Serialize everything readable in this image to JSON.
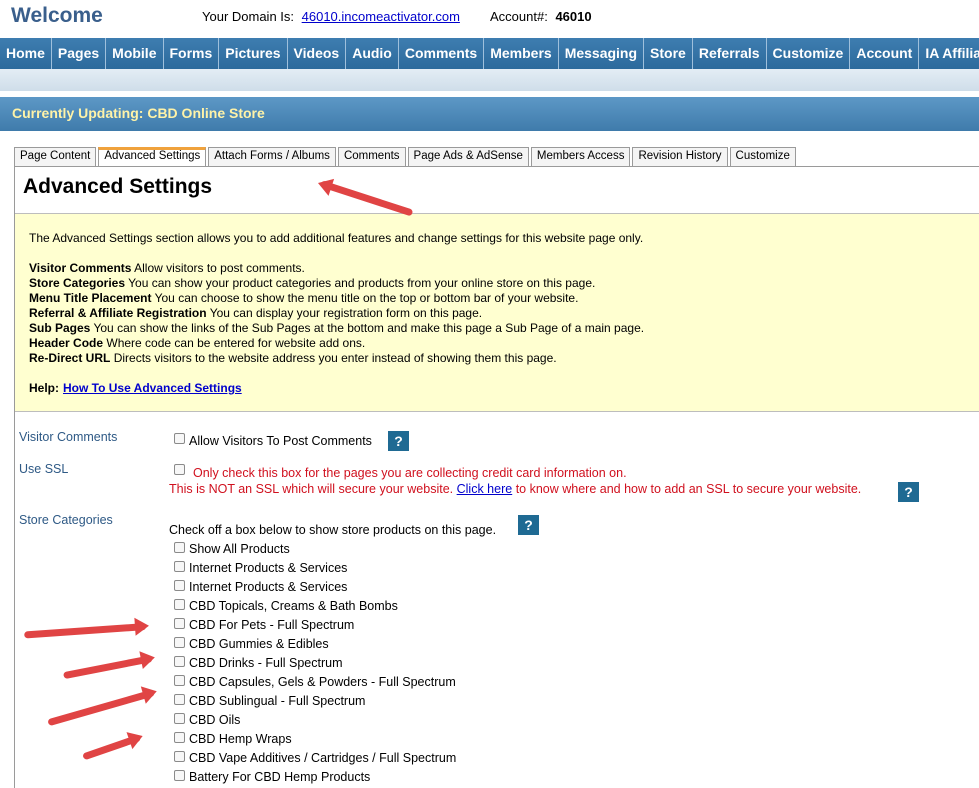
{
  "header": {
    "welcome": "Welcome",
    "domain_label": "Your Domain Is:",
    "domain_link": "46010.incomeactivator.com",
    "account_label": "Account#:",
    "account_number": "46010"
  },
  "nav": {
    "items": [
      "Home",
      "Pages",
      "Mobile",
      "Forms",
      "Pictures",
      "Videos",
      "Audio",
      "Comments",
      "Members",
      "Messaging",
      "Store",
      "Referrals",
      "Customize",
      "Account",
      "IA Affiliates"
    ]
  },
  "updating": {
    "text": "Currently Updating: CBD Online Store"
  },
  "tabs": {
    "items": [
      "Page Content",
      "Advanced Settings",
      "Attach Forms / Albums",
      "Comments",
      "Page Ads & AdSense",
      "Members Access",
      "Revision History",
      "Customize"
    ],
    "active": "Advanced Settings"
  },
  "page": {
    "title": "Advanced Settings"
  },
  "info": {
    "intro": "The Advanced Settings section allows you to add additional features and change settings for this website page only.",
    "definitions": [
      {
        "term": "Visitor Comments",
        "desc": "Allow visitors to post comments."
      },
      {
        "term": "Store Categories",
        "desc": "You can show your product categories and products from your online store on this page."
      },
      {
        "term": "Menu Title Placement",
        "desc": "You can choose to show the menu title on the top or bottom bar of your website."
      },
      {
        "term": "Referral & Affiliate Registration",
        "desc": "You can display your registration form on this page."
      },
      {
        "term": "Sub Pages",
        "desc": "You can show the links of the Sub Pages at the bottom and make this page a Sub Page of a main page."
      },
      {
        "term": "Header Code",
        "desc": "Where code can be entered for website add ons."
      },
      {
        "term": "Re-Direct URL",
        "desc": "Directs visitors to the website address you enter instead of showing them this page."
      }
    ],
    "help_label": "Help:",
    "help_link": "How To Use Advanced Settings"
  },
  "settings": {
    "visitor_comments": {
      "label": "Visitor Comments",
      "option": "Allow Visitors To Post Comments",
      "checked": false
    },
    "use_ssl": {
      "label": "Use SSL",
      "warning1": "Only check this box for the pages you are collecting credit card information on.",
      "warning2_pre": "This is NOT an SSL which will secure your website.",
      "warning2_link": "Click here",
      "warning2_post": "to know where and how to add an SSL to secure your website.",
      "checked": false
    },
    "store_categories": {
      "label": "Store Categories",
      "instruction": "Check off a box below to show store products on this page.",
      "items": [
        "Show All Products",
        "Internet Products & Services",
        "Internet Products & Services",
        "CBD Topicals, Creams & Bath Bombs",
        "CBD For Pets - Full Spectrum",
        "CBD Gummies & Edibles",
        "CBD Drinks - Full Spectrum",
        "CBD Capsules, Gels & Powders - Full Spectrum",
        "CBD Sublingual - Full Spectrum",
        "CBD Oils",
        "CBD Hemp Wraps",
        "CBD Vape Additives / Cartridges / Full Spectrum",
        "Battery For CBD Hemp Products"
      ]
    }
  },
  "icons": {
    "help_button": "?"
  },
  "colors": {
    "nav_bar": "#2c6a9c",
    "update_text": "#fff3a8",
    "info_background": "#ffffd0",
    "warning_red": "#d0101e",
    "help_button": "#1f6a93",
    "annotation_arrow": "#e04444"
  }
}
